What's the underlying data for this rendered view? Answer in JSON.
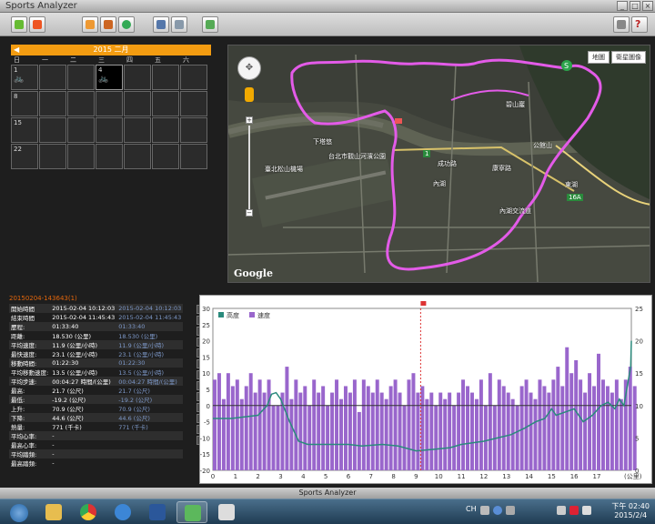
{
  "window": {
    "title": "Sports Analyzer"
  },
  "status_bar": {
    "text": "Sports Analyzer"
  },
  "calendar": {
    "header": "2015 二月",
    "weekdays": [
      "日",
      "一",
      "二",
      "三",
      "四",
      "五",
      "六"
    ],
    "cells": [
      {
        "day": "1",
        "activity": true,
        "selected": false
      },
      {
        "day": "",
        "activity": false,
        "selected": false
      },
      {
        "day": "",
        "activity": false,
        "selected": false
      },
      {
        "day": "4",
        "activity": true,
        "selected": true
      },
      {
        "day": "",
        "activity": false,
        "selected": false
      },
      {
        "day": "",
        "activity": false,
        "selected": false
      },
      {
        "day": "",
        "activity": false,
        "selected": false
      },
      {
        "day": "8",
        "activity": false,
        "selected": false
      },
      {
        "day": "",
        "activity": false,
        "selected": false
      },
      {
        "day": "",
        "activity": false,
        "selected": false
      },
      {
        "day": "",
        "activity": false,
        "selected": false
      },
      {
        "day": "",
        "activity": false,
        "selected": false
      },
      {
        "day": "",
        "activity": false,
        "selected": false
      },
      {
        "day": "",
        "activity": false,
        "selected": false
      },
      {
        "day": "15",
        "activity": false,
        "selected": false
      },
      {
        "day": "",
        "activity": false,
        "selected": false
      },
      {
        "day": "",
        "activity": false,
        "selected": false
      },
      {
        "day": "",
        "activity": false,
        "selected": false
      },
      {
        "day": "",
        "activity": false,
        "selected": false
      },
      {
        "day": "",
        "activity": false,
        "selected": false
      },
      {
        "day": "",
        "activity": false,
        "selected": false
      },
      {
        "day": "22",
        "activity": false,
        "selected": false
      },
      {
        "day": "",
        "activity": false,
        "selected": false
      },
      {
        "day": "",
        "activity": false,
        "selected": false
      },
      {
        "day": "",
        "activity": false,
        "selected": false
      },
      {
        "day": "",
        "activity": false,
        "selected": false
      },
      {
        "day": "",
        "activity": false,
        "selected": false
      },
      {
        "day": "",
        "activity": false,
        "selected": false
      }
    ]
  },
  "map": {
    "type_buttons": [
      "地圖",
      "衛星圖像"
    ],
    "logo": "Google",
    "labels": [
      {
        "text": "下塔悠",
        "kind": "white"
      },
      {
        "text": "台北市觀山河濱公園",
        "kind": "white"
      },
      {
        "text": "臺北松山機場",
        "kind": "white"
      },
      {
        "text": "內湖",
        "kind": "white"
      },
      {
        "text": "內湖交流道",
        "kind": "white"
      },
      {
        "text": "東湖",
        "kind": "white"
      },
      {
        "text": "碧山巖",
        "kind": "white"
      },
      {
        "text": "公館山",
        "kind": "white"
      },
      {
        "text": "康寧路",
        "kind": "white"
      },
      {
        "text": "成功路",
        "kind": "white"
      },
      {
        "text": "16A",
        "kind": "shield"
      },
      {
        "text": "1",
        "kind": "shield"
      }
    ]
  },
  "stats": {
    "title": "20150204-143643(1)",
    "rows": [
      {
        "label": "開始時間",
        "v1": "2015-02-04 10:12:03",
        "v2": "2015-02-04 10:12:03"
      },
      {
        "label": "結束時間",
        "v1": "2015-02-04 11:45:43",
        "v2": "2015-02-04 11:45:43"
      },
      {
        "label": "歷程:",
        "v1": "01:33:40",
        "v2": "01:33:40"
      },
      {
        "label": "距離:",
        "v1": "18.530 (公里)",
        "v2": "18.530 (公里)"
      },
      {
        "label": "平均速度:",
        "v1": "11.9 (公里/小時)",
        "v2": "11.9 (公里/小時)"
      },
      {
        "label": "最快速度:",
        "v1": "23.1 (公里/小時)",
        "v2": "23.1 (公里/小時)"
      },
      {
        "label": "移動時間:",
        "v1": "01:22:30",
        "v2": "01:22:30"
      },
      {
        "label": "平均移動速度:",
        "v1": "13.5 (公里/小時)",
        "v2": "13.5 (公里/小時)"
      },
      {
        "label": "平均步速:",
        "v1": "00:04:27 時間/(公里)",
        "v2": "00:04:27 時間/(公里)"
      },
      {
        "label": "最高:",
        "v1": "21.7 (公尺)",
        "v2": "21.7 (公尺)"
      },
      {
        "label": "最低:",
        "v1": "-19.2 (公尺)",
        "v2": "-19.2 (公尺)"
      },
      {
        "label": "上升:",
        "v1": "70.9 (公尺)",
        "v2": "70.9 (公尺)"
      },
      {
        "label": "下降:",
        "v1": "44.6 (公尺)",
        "v2": "44.6 (公尺)"
      },
      {
        "label": "熱量:",
        "v1": "771 (千卡)",
        "v2": "771 (千卡)"
      },
      {
        "label": "平均心率:",
        "v1": "-",
        "v2": ""
      },
      {
        "label": "最高心率:",
        "v1": "-",
        "v2": ""
      },
      {
        "label": "平均踏頻:",
        "v1": "-",
        "v2": ""
      },
      {
        "label": "最高踏頻:",
        "v1": "-",
        "v2": ""
      }
    ]
  },
  "colors": {
    "route": "#e35be8",
    "speed_bar": "#9966cc",
    "altitude_line": "#2a8a7c",
    "accent": "#f39c11"
  },
  "chart_data": {
    "type": "bar",
    "x_unit_label": "(公里)",
    "x_ticks": [
      "0",
      "1",
      "2",
      "3",
      "4",
      "5",
      "6",
      "7",
      "8",
      "9",
      "10",
      "11",
      "12",
      "13",
      "14",
      "15",
      "16",
      "17"
    ],
    "y_left_ticks": [
      "-20",
      "-15",
      "-10",
      "-5",
      "0",
      "5",
      "10",
      "15",
      "20",
      "25",
      "30"
    ],
    "y_right_ticks": [
      "0",
      "5",
      "10",
      "15",
      "20",
      "25"
    ],
    "y_left_range": [
      -20,
      30
    ],
    "y_right_range": [
      0,
      25
    ],
    "x_range": [
      0,
      18.53
    ],
    "legend": [
      "高度",
      "速度"
    ],
    "series": [
      {
        "name": "速度",
        "axis": "right",
        "x_step": 0.2,
        "values": [
          14,
          15,
          11,
          15,
          13,
          14,
          11,
          13,
          15,
          12,
          14,
          12,
          14,
          10,
          10,
          12,
          16,
          11,
          14,
          12,
          13,
          10,
          14,
          12,
          13,
          10,
          12,
          14,
          11,
          13,
          12,
          14,
          9,
          14,
          13,
          12,
          14,
          12,
          11,
          13,
          14,
          12,
          10,
          14,
          15,
          12,
          13,
          11,
          12,
          10,
          12,
          11,
          12,
          10,
          12,
          14,
          13,
          12,
          11,
          14,
          10,
          15,
          10,
          14,
          13,
          12,
          11,
          10,
          13,
          14,
          12,
          11,
          14,
          13,
          12,
          14,
          16,
          13,
          19,
          15,
          17,
          14,
          12,
          15,
          13,
          18,
          14,
          13,
          12,
          14,
          11,
          14,
          16,
          13
        ]
      },
      {
        "name": "高度",
        "axis": "left",
        "points": [
          [
            0,
            -4
          ],
          [
            0.8,
            -4
          ],
          [
            1.4,
            -3.5
          ],
          [
            2,
            -3
          ],
          [
            2.4,
            0
          ],
          [
            2.6,
            3.5
          ],
          [
            2.8,
            4
          ],
          [
            3,
            2
          ],
          [
            3.4,
            -5
          ],
          [
            3.8,
            -11
          ],
          [
            4.2,
            -12
          ],
          [
            5,
            -12
          ],
          [
            6,
            -12
          ],
          [
            6.6,
            -12.5
          ],
          [
            7.5,
            -12
          ],
          [
            8.2,
            -12.5
          ],
          [
            9,
            -14
          ],
          [
            9.8,
            -13.5
          ],
          [
            10.5,
            -13
          ],
          [
            11,
            -12
          ],
          [
            12,
            -11
          ],
          [
            12.6,
            -10
          ],
          [
            13.2,
            -9
          ],
          [
            13.8,
            -7
          ],
          [
            14.3,
            -5
          ],
          [
            14.7,
            -4
          ],
          [
            15,
            -1
          ],
          [
            15.2,
            -3
          ],
          [
            15.6,
            -2
          ],
          [
            16,
            -1
          ],
          [
            16.4,
            -5
          ],
          [
            16.8,
            -3
          ],
          [
            17.2,
            0
          ],
          [
            17.5,
            1
          ],
          [
            17.8,
            -1
          ],
          [
            18,
            2
          ],
          [
            18.2,
            0
          ],
          [
            18.5,
            12
          ],
          [
            18.53,
            20
          ]
        ]
      }
    ],
    "marker_km": 9.2
  }
}
